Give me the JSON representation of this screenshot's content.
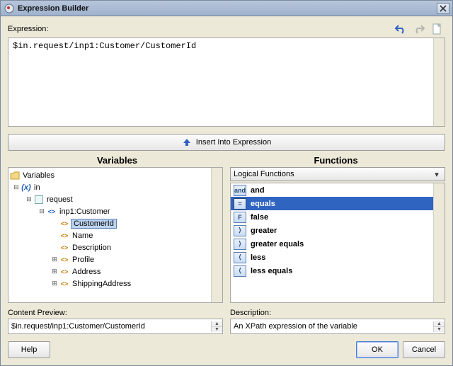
{
  "title": "Expression Builder",
  "expression_label": "Expression:",
  "expression_value": "$in.request/inp1:Customer/CustomerId",
  "insert_button_label": "Insert Into Expression",
  "variables_header": "Variables",
  "functions_header": "Functions",
  "variables_root": "Variables",
  "tree": {
    "in": "in",
    "request": "request",
    "customer": "inp1:Customer",
    "customerId": "CustomerId",
    "name": "Name",
    "description": "Description",
    "profile": "Profile",
    "address": "Address",
    "shippingAddress": "ShippingAddress"
  },
  "functions_category": "Logical Functions",
  "functions": [
    {
      "icon": "and",
      "name": "and",
      "selected": false
    },
    {
      "icon": "=",
      "name": "equals",
      "selected": true
    },
    {
      "icon": "F",
      "name": "false",
      "selected": false
    },
    {
      "icon": "⟩",
      "name": "greater",
      "selected": false
    },
    {
      "icon": "⟩",
      "name": "greater equals",
      "selected": false
    },
    {
      "icon": "⟨",
      "name": "less",
      "selected": false
    },
    {
      "icon": "⟨",
      "name": "less equals",
      "selected": false
    }
  ],
  "content_preview_label": "Content Preview:",
  "content_preview_value": "$in.request/inp1:Customer/CustomerId",
  "description_label": "Description:",
  "description_value": "An XPath expression of the variable",
  "buttons": {
    "help": "Help",
    "ok": "OK",
    "cancel": "Cancel"
  }
}
